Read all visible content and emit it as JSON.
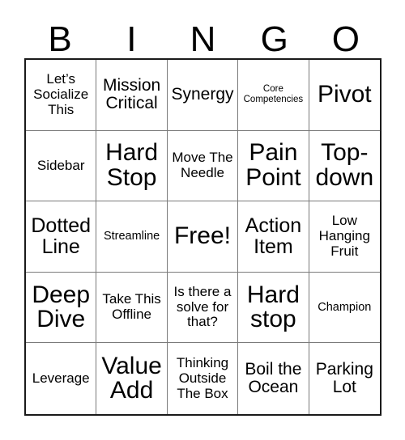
{
  "card": {
    "title": "BINGO",
    "header_letters": [
      "B",
      "I",
      "N",
      "G",
      "O"
    ],
    "colors": {
      "background": "#ffffff",
      "text": "#000000",
      "outer_border": "#1a1a1a",
      "inner_border": "#7a7a7a"
    },
    "grid": {
      "columns": 5,
      "rows": 5,
      "free_space": "Free!"
    },
    "cells": [
      {
        "text": "Let’s Socialize This",
        "size": "fs-md"
      },
      {
        "text": "Mission Critical",
        "size": "fs-lg"
      },
      {
        "text": "Synergy",
        "size": "fs-lg"
      },
      {
        "text": "Core Competencies",
        "size": "fs-xs"
      },
      {
        "text": "Pivot",
        "size": "fs-xxl"
      },
      {
        "text": "Sidebar",
        "size": "fs-md"
      },
      {
        "text": "Hard Stop",
        "size": "fs-xxl"
      },
      {
        "text": "Move The Needle",
        "size": "fs-md"
      },
      {
        "text": "Pain Point",
        "size": "fs-xxl"
      },
      {
        "text": "Top-down",
        "size": "fs-xxl"
      },
      {
        "text": "Dotted Line",
        "size": "fs-xl"
      },
      {
        "text": "Streamline",
        "size": "fs-sm"
      },
      {
        "text": "Free!",
        "size": "fs-xxl"
      },
      {
        "text": "Action Item",
        "size": "fs-xl"
      },
      {
        "text": "Low Hanging Fruit",
        "size": "fs-md"
      },
      {
        "text": "Deep Dive",
        "size": "fs-xxl"
      },
      {
        "text": "Take This Offline",
        "size": "fs-md"
      },
      {
        "text": "Is there a solve for that?",
        "size": "fs-md"
      },
      {
        "text": "Hard stop",
        "size": "fs-xxl"
      },
      {
        "text": "Champion",
        "size": "fs-sm"
      },
      {
        "text": "Leverage",
        "size": "fs-md"
      },
      {
        "text": "Value Add",
        "size": "fs-xxl"
      },
      {
        "text": "Thinking Outside The Box",
        "size": "fs-md"
      },
      {
        "text": "Boil the Ocean",
        "size": "fs-lg"
      },
      {
        "text": "Parking Lot",
        "size": "fs-lg"
      }
    ]
  }
}
